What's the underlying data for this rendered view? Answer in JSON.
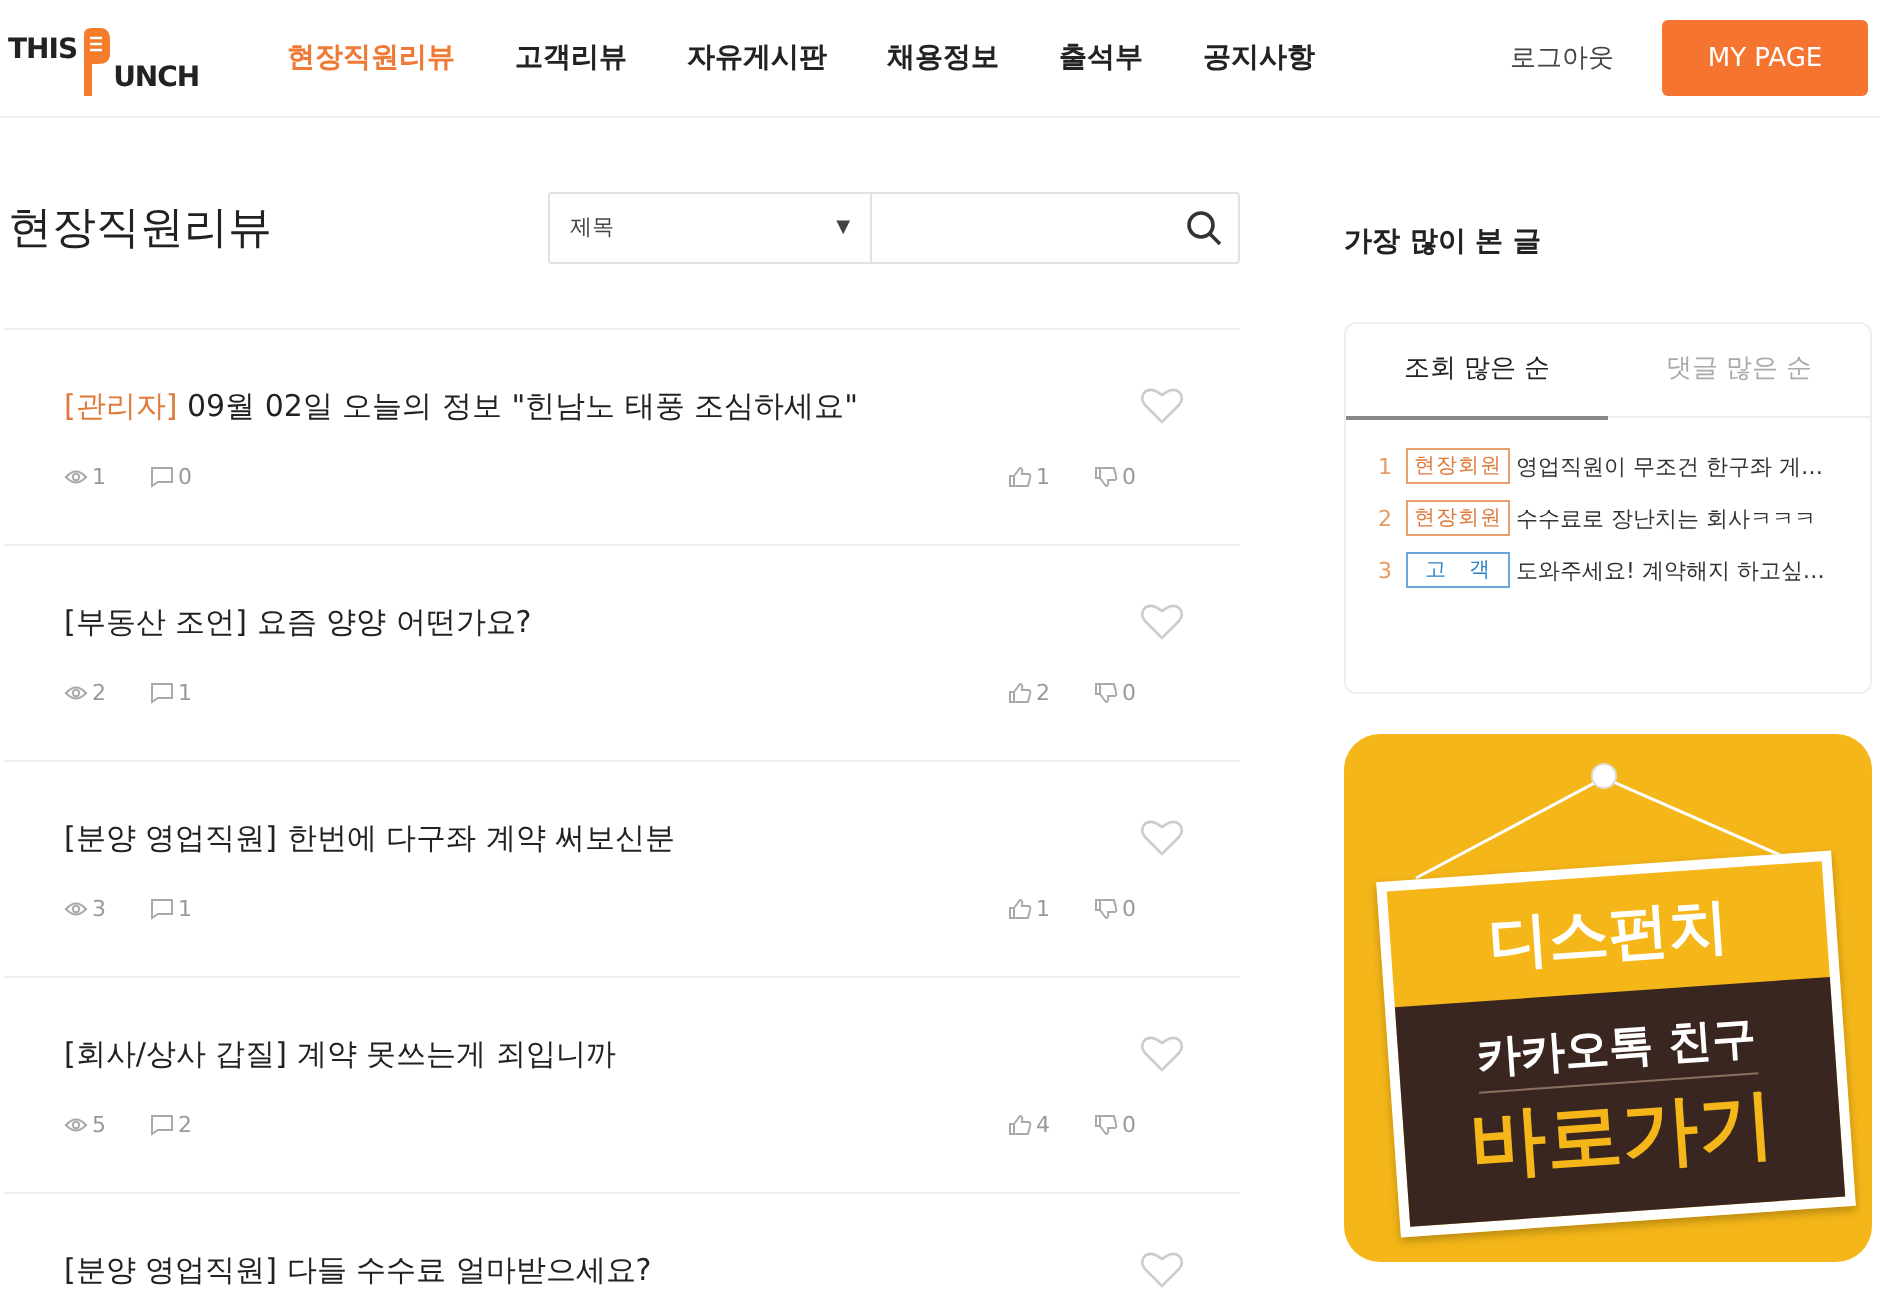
{
  "header": {
    "logo": {
      "top": "THIS",
      "bottom": "UNCH"
    },
    "nav": [
      {
        "label": "현장직원리뷰",
        "selected": true
      },
      {
        "label": "고객리뷰",
        "selected": false
      },
      {
        "label": "자유게시판",
        "selected": false
      },
      {
        "label": "채용정보",
        "selected": false
      },
      {
        "label": "출석부",
        "selected": false
      },
      {
        "label": "공지사항",
        "selected": false
      }
    ],
    "logout": "로그아웃",
    "mypage": "MY PAGE"
  },
  "board": {
    "title": "현장직원리뷰",
    "search": {
      "select": "제목",
      "caret": "▼"
    },
    "posts": [
      {
        "tag": "[관리자]",
        "kind": "admin",
        "title": "09월 02일 오늘의 정보 \"힌남노 태풍 조심하세요\"",
        "views": "1",
        "comments": "0",
        "likes": "1",
        "dislikes": "0"
      },
      {
        "tag": "[부동산 조언]",
        "kind": "normal",
        "title": "요즘 양양 어떤가요?",
        "views": "2",
        "comments": "1",
        "likes": "2",
        "dislikes": "0"
      },
      {
        "tag": "[분양 영업직원]",
        "kind": "normal",
        "title": "한번에 다구좌 계약 써보신분",
        "views": "3",
        "comments": "1",
        "likes": "1",
        "dislikes": "0"
      },
      {
        "tag": "[회사/상사 갑질]",
        "kind": "normal",
        "title": "계약 못쓰는게 죄입니까",
        "views": "5",
        "comments": "2",
        "likes": "4",
        "dislikes": "0"
      },
      {
        "tag": "[분양 영업직원]",
        "kind": "normal",
        "title": "다들 수수료 얼마받으세요?"
      }
    ]
  },
  "sidebar": {
    "title": "가장 많이 본 글",
    "tabs": [
      {
        "label": "조회 많은 순",
        "selected": true
      },
      {
        "label": "댓글 많은 순",
        "selected": false
      }
    ],
    "items": [
      {
        "rank": "1",
        "badge": "현장회원",
        "kind": "staff",
        "title": "영업직원이 무조건 한구좌 게…"
      },
      {
        "rank": "2",
        "badge": "현장회원",
        "kind": "staff",
        "title": "수수료로 장난치는 회사ㅋㅋㅋ"
      },
      {
        "rank": "3",
        "badge": "고　객",
        "kind": "customer",
        "title": "도와주세요! 계약해지 하고싶…"
      }
    ],
    "banner": {
      "line1": "디스펀치",
      "line2": "카카오톡 친구",
      "line3": "바로가기"
    }
  }
}
